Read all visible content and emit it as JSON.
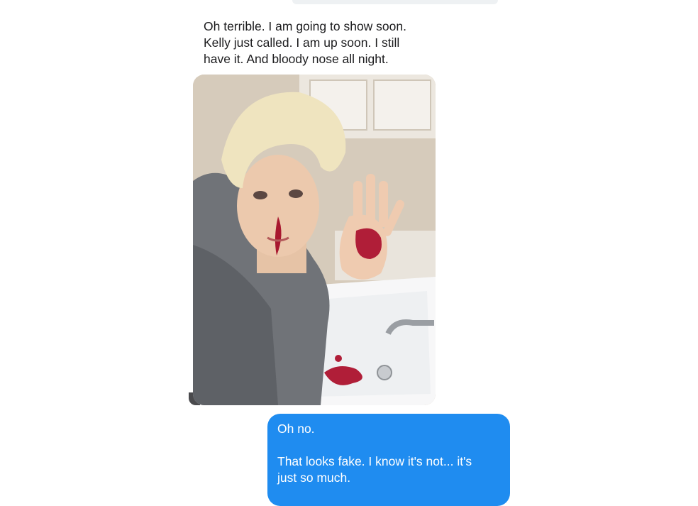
{
  "conversation": {
    "incoming_message": {
      "text": "Oh terrible. I am going to show soon.\nKelly just called. I am up soon. I still\nhave it. And bloody nose all night.",
      "photo": {
        "icon": "photo-attachment"
      }
    },
    "outgoing_message": {
      "line1": "Oh no.",
      "line2": "That looks fake. I know it's not... it's\njust so much."
    }
  },
  "colors": {
    "incoming_text": "#1c1c1e",
    "outgoing_bubble": "#1f8cf0",
    "outgoing_text": "#ffffff"
  }
}
